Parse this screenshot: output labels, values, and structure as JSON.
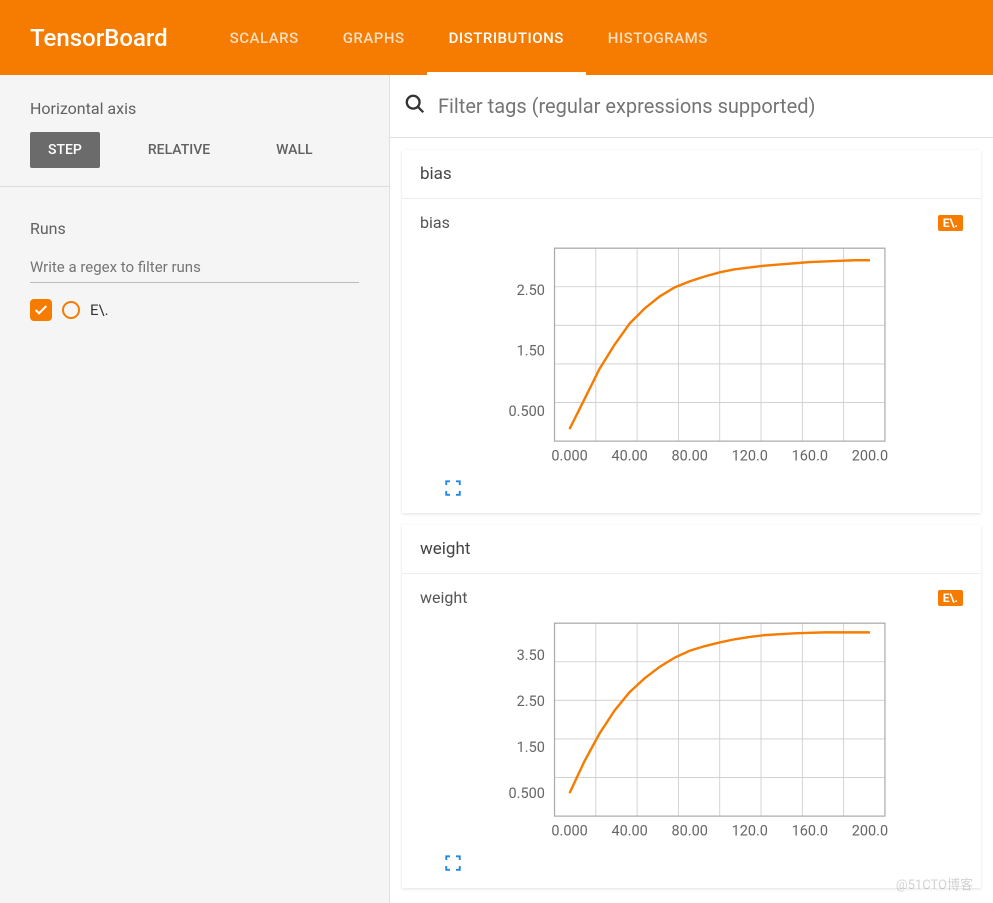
{
  "header": {
    "logo": "TensorBoard",
    "tabs": [
      "SCALARS",
      "GRAPHS",
      "DISTRIBUTIONS",
      "HISTOGRAMS"
    ],
    "active_tab": 2
  },
  "sidebar": {
    "axis": {
      "title": "Horizontal axis",
      "buttons": [
        "STEP",
        "RELATIVE",
        "WALL"
      ],
      "active": 0
    },
    "runs": {
      "title": "Runs",
      "filter_placeholder": "Write a regex to filter runs",
      "items": [
        {
          "name": "E\\.",
          "checked": true
        }
      ]
    }
  },
  "main": {
    "filter_placeholder": "Filter tags (regular expressions supported)",
    "cards": [
      {
        "group": "bias",
        "plot_title": "bias",
        "badge": "E\\."
      },
      {
        "group": "weight",
        "plot_title": "weight",
        "badge": "E\\."
      }
    ]
  },
  "chart_data": [
    {
      "type": "line",
      "title": "bias",
      "xlabel": "",
      "ylabel": "",
      "x": [
        0,
        10,
        20,
        30,
        40,
        50,
        60,
        70,
        80,
        90,
        100,
        110,
        120,
        130,
        140,
        150,
        160,
        170,
        180,
        190,
        200
      ],
      "series": [
        {
          "name": "E\\.",
          "values": [
            0.2,
            0.7,
            1.2,
            1.6,
            1.95,
            2.2,
            2.4,
            2.55,
            2.65,
            2.73,
            2.8,
            2.85,
            2.88,
            2.91,
            2.93,
            2.95,
            2.97,
            2.98,
            2.99,
            3.0,
            3.0
          ]
        }
      ],
      "xticks": [
        "0.000",
        "40.00",
        "80.00",
        "120.0",
        "160.0",
        "200.0"
      ],
      "xtv": [
        0,
        40,
        80,
        120,
        160,
        200
      ],
      "yticks": [
        "0.500",
        "1.50",
        "2.50"
      ],
      "ytv": [
        0.5,
        1.5,
        2.5
      ],
      "xlim": [
        -10,
        210
      ],
      "ylim": [
        0,
        3.2
      ]
    },
    {
      "type": "line",
      "title": "weight",
      "xlabel": "",
      "ylabel": "",
      "x": [
        0,
        10,
        20,
        30,
        40,
        50,
        60,
        70,
        80,
        90,
        100,
        110,
        120,
        130,
        140,
        150,
        160,
        170,
        180,
        190,
        200
      ],
      "series": [
        {
          "name": "E\\.",
          "values": [
            0.5,
            1.2,
            1.8,
            2.3,
            2.7,
            3.0,
            3.25,
            3.45,
            3.6,
            3.7,
            3.78,
            3.85,
            3.9,
            3.94,
            3.96,
            3.98,
            3.99,
            4.0,
            4.0,
            4.0,
            4.0
          ]
        }
      ],
      "xticks": [
        "0.000",
        "40.00",
        "80.00",
        "120.0",
        "160.0",
        "200.0"
      ],
      "xtv": [
        0,
        40,
        80,
        120,
        160,
        200
      ],
      "yticks": [
        "0.500",
        "1.50",
        "2.50",
        "3.50"
      ],
      "ytv": [
        0.5,
        1.5,
        2.5,
        3.5
      ],
      "xlim": [
        -10,
        210
      ],
      "ylim": [
        0,
        4.2
      ]
    }
  ],
  "watermark": "@51CTO博客",
  "colors": {
    "accent": "#f57c00",
    "line": "#f57c00"
  }
}
